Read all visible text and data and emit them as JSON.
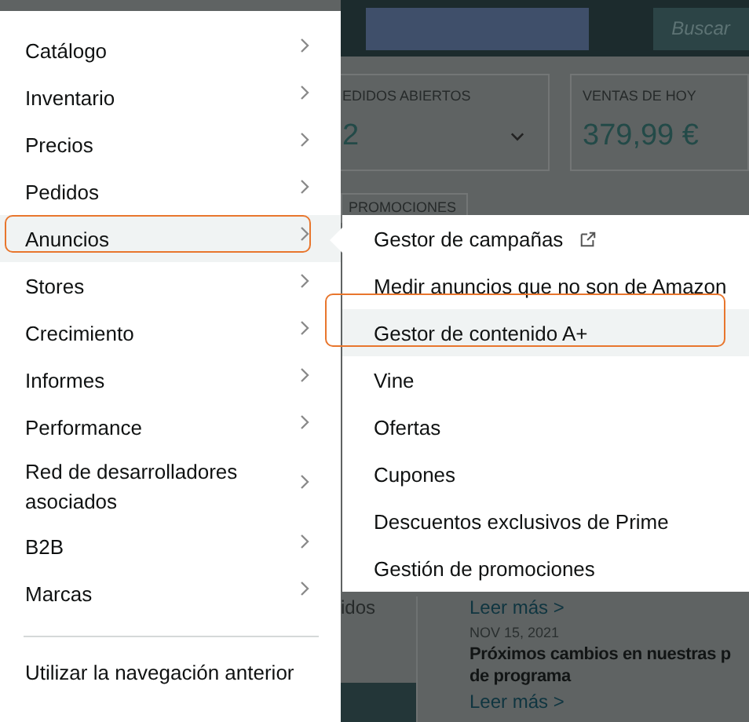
{
  "header": {
    "search_button": "Buscar"
  },
  "cards": [
    {
      "label": "EDIDOS ABIERTOS",
      "value": "2",
      "dropdown": true
    },
    {
      "label": "VENTAS DE HOY",
      "value": "379,99 €",
      "dropdown": false
    }
  ],
  "tab": "PROMOCIONES",
  "news": {
    "fragment": "idos",
    "items": [
      {
        "link": "Leer más >"
      },
      {
        "date": "NOV 15, 2021",
        "title": "Próximos cambios en nuestras p\nde programa",
        "link": "Leer más >"
      }
    ]
  },
  "menu": {
    "items": [
      {
        "label": "Catálogo",
        "submenu": true,
        "selected": false,
        "annotated": false
      },
      {
        "label": "Inventario",
        "submenu": true,
        "selected": false,
        "annotated": false
      },
      {
        "label": "Precios",
        "submenu": true,
        "selected": false,
        "annotated": false
      },
      {
        "label": "Pedidos",
        "submenu": true,
        "selected": false,
        "annotated": false
      },
      {
        "label": "Anuncios",
        "submenu": true,
        "selected": true,
        "annotated": true
      },
      {
        "label": "Stores",
        "submenu": true,
        "selected": false,
        "annotated": false
      },
      {
        "label": "Crecimiento",
        "submenu": true,
        "selected": false,
        "annotated": false
      },
      {
        "label": "Informes",
        "submenu": true,
        "selected": false,
        "annotated": false
      },
      {
        "label": "Performance",
        "submenu": true,
        "selected": false,
        "annotated": false
      },
      {
        "label": "Red de desarrolladores asociados",
        "submenu": true,
        "selected": false,
        "annotated": false
      },
      {
        "label": "B2B",
        "submenu": true,
        "selected": false,
        "annotated": false
      },
      {
        "label": "Marcas",
        "submenu": true,
        "selected": false,
        "annotated": false
      }
    ],
    "footer_link": "Utilizar la navegación anterior"
  },
  "submenu": {
    "items": [
      {
        "label": "Gestor de campañas",
        "external": true,
        "selected": false,
        "annotated": false
      },
      {
        "label": "Medir anuncios que no son de Amazon",
        "external": false,
        "selected": false,
        "annotated": false
      },
      {
        "label": "Gestor de contenido A+",
        "external": false,
        "selected": true,
        "annotated": true
      },
      {
        "label": "Vine",
        "external": false,
        "selected": false,
        "annotated": false
      },
      {
        "label": "Ofertas",
        "external": false,
        "selected": false,
        "annotated": false
      },
      {
        "label": "Cupones",
        "external": false,
        "selected": false,
        "annotated": false
      },
      {
        "label": "Descuentos exclusivos de Prime",
        "external": false,
        "selected": false,
        "annotated": false
      },
      {
        "label": "Gestión de promociones",
        "external": false,
        "selected": false,
        "annotated": false
      }
    ]
  }
}
